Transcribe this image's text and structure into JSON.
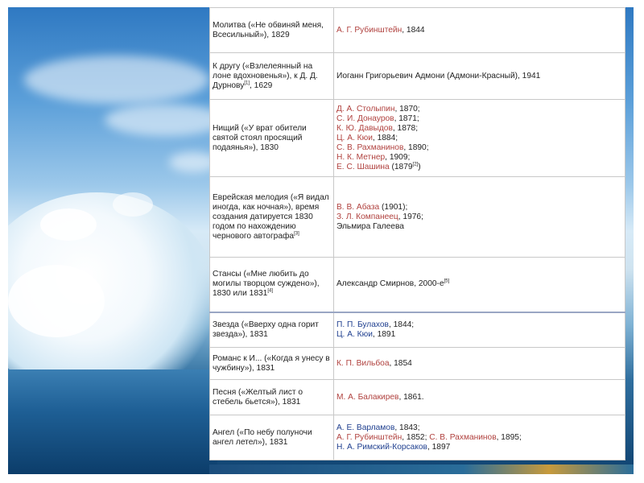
{
  "rows": [
    {
      "poem": "Молитва («Не обвиняй меня, Всесильный»), 1829",
      "settings": [
        {
          "text": "А. Г. Рубинштейн",
          "link": true,
          "rest": ", 1844"
        }
      ]
    },
    {
      "poem": "К другу («Взлелеянный на лоне вдохновенья»), к Д. Д. Дурнову",
      "poem_sup": "[1]",
      "poem_tail": ", 1629",
      "settings": [
        {
          "text": "",
          "link": false,
          "rest": "Иоганн Григорьевич Адмони (Адмони-Красный), 1941"
        }
      ]
    },
    {
      "poem": "Нищий («У врат обители святой стоял просящий подаянья»), 1830",
      "settings": [
        {
          "text": "Д. А. Столыпин",
          "link": true,
          "rest": ", 1870;"
        },
        {
          "text": "С. И. Донауров",
          "link": true,
          "rest": ", 1871;"
        },
        {
          "text": "К. Ю. Давыдов",
          "link": true,
          "rest": ", 1878;"
        },
        {
          "text": "Ц. А. Кюи",
          "link": true,
          "rest": ", 1884;"
        },
        {
          "text": "С. В. Рахманинов",
          "link": true,
          "rest": ", 1890;"
        },
        {
          "text": "Н. К. Метнер",
          "link": true,
          "rest": ", 1909;"
        },
        {
          "text": "Е. С. Шашина",
          "link": true,
          "rest": " (1879",
          "sup": "[2]",
          "tail": ")"
        }
      ]
    },
    {
      "poem": "Еврейская мелодия («Я видал иногда, как ночная»), время создания датируется 1830 годом по нахождению чернового автографа",
      "poem_sup": "[3]",
      "poem_tail": "",
      "settings": [
        {
          "text": "В. В. Абаза",
          "link": true,
          "rest": " (1901);"
        },
        {
          "text": "З. Л. Компанеец",
          "link": true,
          "rest": ", 1976;"
        },
        {
          "text": "",
          "link": false,
          "rest": "Эльмира Галеева"
        }
      ]
    },
    {
      "poem": "Стансы («Мне любить до могилы творцом суждено»), 1830 или 1831",
      "poem_sup": "[4]",
      "poem_tail": "",
      "settings": [
        {
          "text": "",
          "link": false,
          "rest": "Александр Смирнов, 2000-е",
          "sup": "[5]",
          "tail": ""
        }
      ]
    },
    {
      "poem": "Звезда («Вверху одна горит звезда»), 1831",
      "settings": [
        {
          "text": "П. П. Булахов",
          "link": true,
          "blue": true,
          "rest": ", 1844;"
        },
        {
          "text": "Ц. А. Кюи",
          "link": true,
          "blue": true,
          "rest": ", 1891"
        }
      ]
    },
    {
      "poem": "Романс к И... («Когда я унесу в чужбину»), 1831",
      "settings": [
        {
          "text": "К. П. Вильбоа",
          "link": true,
          "rest": ", 1854"
        }
      ]
    },
    {
      "poem": "Песня («Желтый лист о стебель бьется»), 1831",
      "settings": [
        {
          "text": "М. А. Балакирев",
          "link": true,
          "rest": ", 1861."
        }
      ]
    },
    {
      "poem": "Ангел («По небу полуночи ангел летел»), 1831",
      "settings": [
        {
          "text": "А. Е. Варламов",
          "link": true,
          "blue": true,
          "rest": ", 1843;"
        },
        {
          "text": "А. Г. Рубинштейн",
          "link": true,
          "rest": ", 1852; ",
          "inline_link": "С. В. Рахманинов",
          "inline_rest": ", 1895;"
        },
        {
          "text": "Н. А. Римский-Корсаков",
          "link": true,
          "blue": true,
          "rest": ", 1897"
        }
      ]
    }
  ]
}
